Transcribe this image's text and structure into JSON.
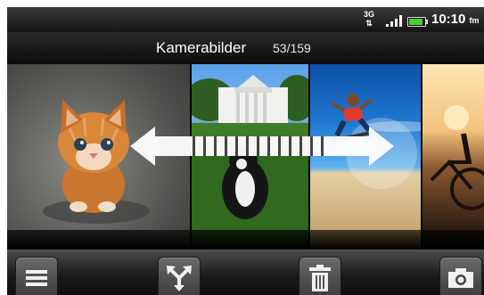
{
  "status_bar": {
    "network": "3G",
    "time": "10:10",
    "time_suffix": "fm",
    "icons": [
      "3g-data-icon",
      "signal-strength-icon",
      "battery-icon"
    ]
  },
  "header": {
    "title": "Kamerabilder",
    "counter": "53/159"
  },
  "gallery": {
    "photos": [
      {
        "name": "kitten-photo"
      },
      {
        "name": "white-house-dog-photo"
      },
      {
        "name": "skateboarder-photo"
      },
      {
        "name": "bicycle-sunset-photo"
      }
    ],
    "gesture_hint": "swipe-left-right-arrow"
  },
  "toolbar": {
    "buttons": [
      {
        "name": "menu-button",
        "icon": "menu-icon"
      },
      {
        "name": "share-button",
        "icon": "share-icon"
      },
      {
        "name": "delete-button",
        "icon": "trash-icon"
      },
      {
        "name": "camera-button",
        "icon": "camera-icon"
      }
    ]
  }
}
